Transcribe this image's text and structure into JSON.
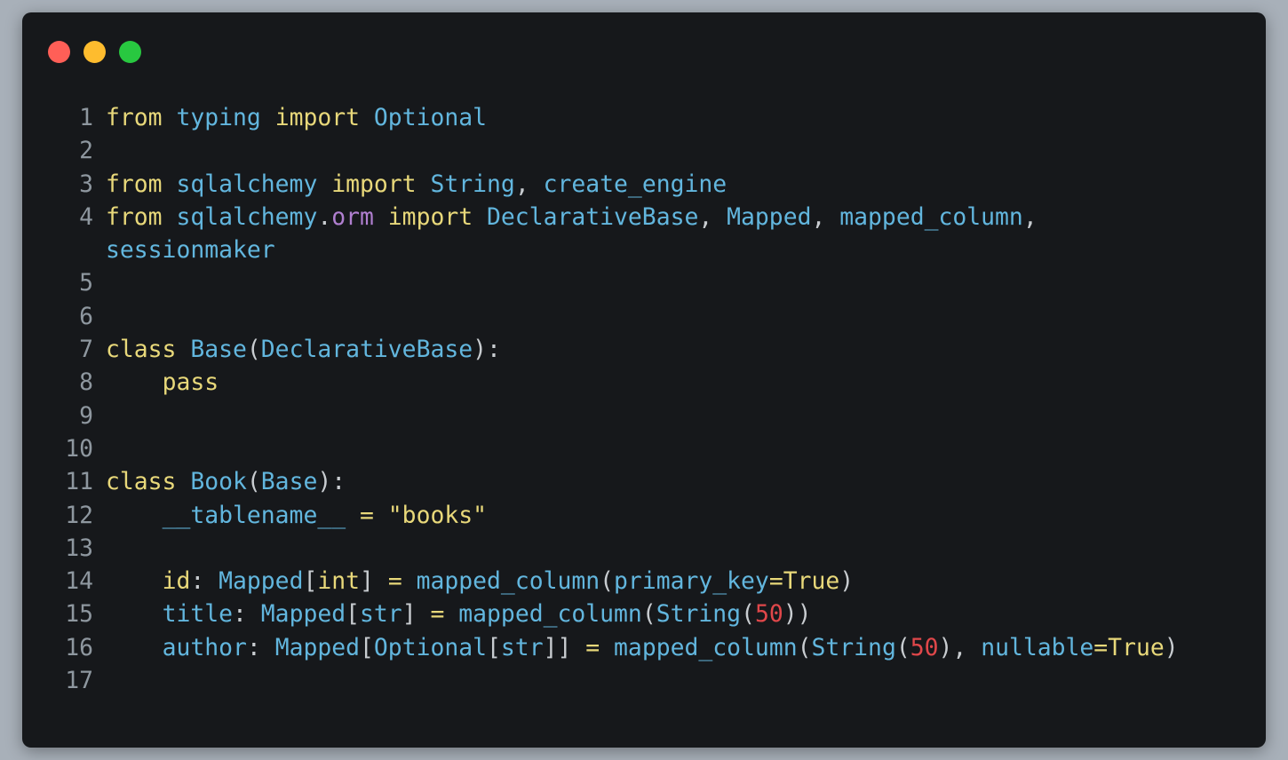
{
  "window": {
    "controls": [
      "close",
      "minimize",
      "maximize"
    ]
  },
  "colors": {
    "background": "#16181b",
    "keyword": "#e8d87a",
    "identifier": "#62b6de",
    "attribute": "#b07fd0",
    "number": "#e0474a",
    "line_number": "#8e979f"
  },
  "lines": [
    {
      "n": "1",
      "tokens": [
        [
          "k",
          "from"
        ],
        [
          "w",
          " "
        ],
        [
          "i",
          "typing"
        ],
        [
          "w",
          " "
        ],
        [
          "k",
          "import"
        ],
        [
          "w",
          " "
        ],
        [
          "i",
          "Optional"
        ]
      ]
    },
    {
      "n": "2",
      "tokens": []
    },
    {
      "n": "3",
      "tokens": [
        [
          "k",
          "from"
        ],
        [
          "w",
          " "
        ],
        [
          "i",
          "sqlalchemy"
        ],
        [
          "w",
          " "
        ],
        [
          "k",
          "import"
        ],
        [
          "w",
          " "
        ],
        [
          "i",
          "String"
        ],
        [
          "w",
          ", "
        ],
        [
          "i",
          "create_engine"
        ]
      ]
    },
    {
      "n": "4",
      "tokens": [
        [
          "k",
          "from"
        ],
        [
          "w",
          " "
        ],
        [
          "i",
          "sqlalchemy"
        ],
        [
          "w",
          "."
        ],
        [
          "p",
          "orm"
        ],
        [
          "w",
          " "
        ],
        [
          "k",
          "import"
        ],
        [
          "w",
          " "
        ],
        [
          "i",
          "DeclarativeBase"
        ],
        [
          "w",
          ", "
        ],
        [
          "i",
          "Mapped"
        ],
        [
          "w",
          ", "
        ],
        [
          "i",
          "mapped_column"
        ],
        [
          "w",
          ","
        ]
      ]
    },
    {
      "n": "",
      "tokens": [
        [
          "i",
          "sessionmaker"
        ]
      ]
    },
    {
      "n": "5",
      "tokens": []
    },
    {
      "n": "6",
      "tokens": []
    },
    {
      "n": "7",
      "tokens": [
        [
          "k",
          "class"
        ],
        [
          "w",
          " "
        ],
        [
          "i",
          "Base"
        ],
        [
          "w",
          "("
        ],
        [
          "i",
          "DeclarativeBase"
        ],
        [
          "w",
          "):"
        ]
      ]
    },
    {
      "n": "8",
      "tokens": [
        [
          "w",
          "    "
        ],
        [
          "k",
          "pass"
        ]
      ]
    },
    {
      "n": "9",
      "tokens": []
    },
    {
      "n": "10",
      "tokens": []
    },
    {
      "n": "11",
      "tokens": [
        [
          "k",
          "class"
        ],
        [
          "w",
          " "
        ],
        [
          "i",
          "Book"
        ],
        [
          "w",
          "("
        ],
        [
          "i",
          "Base"
        ],
        [
          "w",
          "):"
        ]
      ]
    },
    {
      "n": "12",
      "tokens": [
        [
          "w",
          "    "
        ],
        [
          "i",
          "__tablename__"
        ],
        [
          "w",
          " "
        ],
        [
          "k",
          "="
        ],
        [
          "w",
          " "
        ],
        [
          "k",
          "\"books\""
        ]
      ]
    },
    {
      "n": "13",
      "tokens": []
    },
    {
      "n": "14",
      "tokens": [
        [
          "w",
          "    "
        ],
        [
          "k",
          "id"
        ],
        [
          "w",
          ": "
        ],
        [
          "i",
          "Mapped"
        ],
        [
          "w",
          "["
        ],
        [
          "k",
          "int"
        ],
        [
          "w",
          "] "
        ],
        [
          "k",
          "="
        ],
        [
          "w",
          " "
        ],
        [
          "i",
          "mapped_column"
        ],
        [
          "w",
          "("
        ],
        [
          "i",
          "primary_key"
        ],
        [
          "k",
          "=True"
        ],
        [
          "w",
          ")"
        ]
      ]
    },
    {
      "n": "15",
      "tokens": [
        [
          "w",
          "    "
        ],
        [
          "i",
          "title"
        ],
        [
          "w",
          ": "
        ],
        [
          "i",
          "Mapped"
        ],
        [
          "w",
          "["
        ],
        [
          "i",
          "str"
        ],
        [
          "w",
          "] "
        ],
        [
          "k",
          "="
        ],
        [
          "w",
          " "
        ],
        [
          "i",
          "mapped_column"
        ],
        [
          "w",
          "("
        ],
        [
          "i",
          "String"
        ],
        [
          "w",
          "("
        ],
        [
          "n",
          "50"
        ],
        [
          "w",
          "))"
        ]
      ]
    },
    {
      "n": "16",
      "tokens": [
        [
          "w",
          "    "
        ],
        [
          "i",
          "author"
        ],
        [
          "w",
          ": "
        ],
        [
          "i",
          "Mapped"
        ],
        [
          "w",
          "["
        ],
        [
          "i",
          "Optional"
        ],
        [
          "w",
          "["
        ],
        [
          "i",
          "str"
        ],
        [
          "w",
          "]] "
        ],
        [
          "k",
          "="
        ],
        [
          "w",
          " "
        ],
        [
          "i",
          "mapped_column"
        ],
        [
          "w",
          "("
        ],
        [
          "i",
          "String"
        ],
        [
          "w",
          "("
        ],
        [
          "n",
          "50"
        ],
        [
          "w",
          "), "
        ],
        [
          "i",
          "nullable"
        ],
        [
          "k",
          "=True"
        ],
        [
          "w",
          ")"
        ]
      ]
    },
    {
      "n": "17",
      "tokens": []
    }
  ]
}
